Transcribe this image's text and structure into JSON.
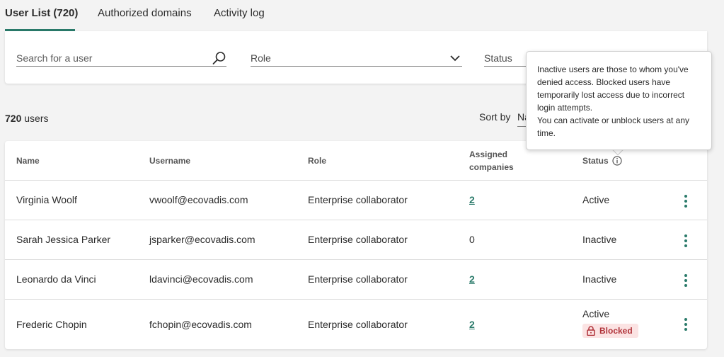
{
  "tabs": [
    {
      "label": "User List (720)",
      "active": true
    },
    {
      "label": "Authorized domains",
      "active": false
    },
    {
      "label": "Activity log",
      "active": false
    }
  ],
  "filters": {
    "search_placeholder": "Search for a user",
    "role_label": "Role",
    "status_label": "Status"
  },
  "summary": {
    "count": "720",
    "count_suffix": " users",
    "sort_label": "Sort by",
    "sort_value": "Na"
  },
  "table": {
    "headers": {
      "name": "Name",
      "username": "Username",
      "role": "Role",
      "assigned_line1": "Assigned",
      "assigned_line2": "companies",
      "status": "Status"
    },
    "rows": [
      {
        "name": "Virginia Woolf",
        "username": "vwoolf@ecovadis.com",
        "role": "Enterprise collaborator",
        "assigned": "2",
        "assigned_link": true,
        "status": "Active",
        "blocked": false
      },
      {
        "name": "Sarah Jessica Parker",
        "username": "jsparker@ecovadis.com",
        "role": "Enterprise collaborator",
        "assigned": "0",
        "assigned_link": false,
        "status": "Inactive",
        "blocked": false
      },
      {
        "name": "Leonardo da Vinci",
        "username": "ldavinci@ecovadis.com",
        "role": "Enterprise collaborator",
        "assigned": "2",
        "assigned_link": true,
        "status": "Inactive",
        "blocked": false
      },
      {
        "name": "Frederic Chopin",
        "username": "fchopin@ecovadis.com",
        "role": "Enterprise collaborator",
        "assigned": "2",
        "assigned_link": true,
        "status": "Active",
        "blocked": true
      }
    ],
    "blocked_label": "Blocked"
  },
  "tooltip": {
    "line1": "Inactive users are those to whom you've",
    "line2": "denied access. Blocked users have",
    "line3": "temporarily lost access due to incorrect",
    "line4": "login attempts.",
    "line5": "You can activate or unblock users at any",
    "line6": "time."
  },
  "colors": {
    "accent": "#2a7a6a",
    "blocked_bg": "#fbe3e3",
    "blocked_text": "#b0333a"
  },
  "icons": {
    "search": "search-icon",
    "chevron": "chevron-down-icon",
    "info": "info-icon",
    "lock": "lock-icon",
    "kebab": "more-vertical-icon"
  }
}
